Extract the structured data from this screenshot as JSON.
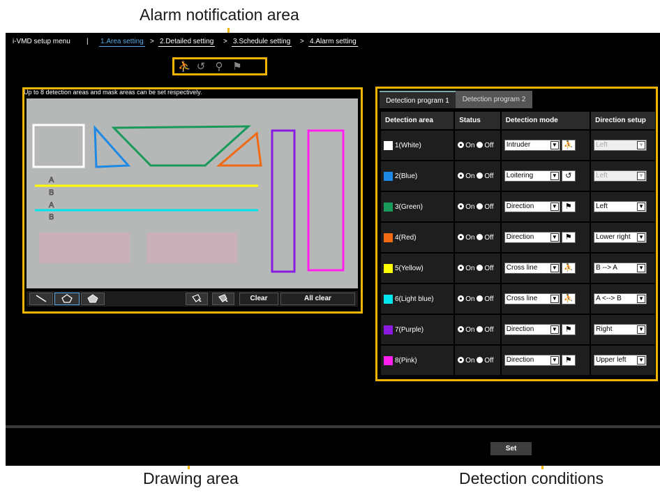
{
  "callouts": {
    "alarm": "Alarm notification area",
    "drawing": "Drawing area",
    "detection": "Detection conditions"
  },
  "nav": {
    "title": "i-VMD setup menu",
    "divider": "|",
    "steps": [
      "1.Area setting",
      "2.Detailed setting",
      "3.Schedule setting",
      "4.Alarm setting"
    ],
    "arrow": ">"
  },
  "alarm_icons": [
    "intruder-icon",
    "loitering-icon",
    "direction-icon",
    "cross-line-icon"
  ],
  "drawing": {
    "hint": "Up to 8 detection areas and mask areas can be set respectively.",
    "line_labels": [
      "A",
      "B",
      "A",
      "B"
    ],
    "toolbar": {
      "clear": "Clear",
      "all_clear": "All clear"
    }
  },
  "conditions": {
    "tabs": [
      "Detection program 1",
      "Detection program 2"
    ],
    "headers": [
      "Detection area",
      "Status",
      "Detection mode",
      "Direction setup"
    ],
    "status_on": "On",
    "status_off": "Off",
    "rows": [
      {
        "area": "1(White)",
        "color": "#ffffff",
        "mode": "Intruder",
        "direction": "Left",
        "dir_disabled": true
      },
      {
        "area": "2(Blue)",
        "color": "#1e88e5",
        "mode": "Loitering",
        "direction": "Left",
        "dir_disabled": true
      },
      {
        "area": "3(Green)",
        "color": "#1a9a5a",
        "mode": "Direction",
        "direction": "Left",
        "dir_disabled": false
      },
      {
        "area": "4(Red)",
        "color": "#f06a14",
        "mode": "Direction",
        "direction": "Lower right",
        "dir_disabled": false
      },
      {
        "area": "5(Yellow)",
        "color": "#ffff00",
        "mode": "Cross line",
        "direction": "B --> A",
        "dir_disabled": false
      },
      {
        "area": "6(Light blue)",
        "color": "#00e5ee",
        "mode": "Cross line",
        "direction": "A <--> B",
        "dir_disabled": false
      },
      {
        "area": "7(Purple)",
        "color": "#8a1ae0",
        "mode": "Direction",
        "direction": "Right",
        "dir_disabled": false
      },
      {
        "area": "8(Pink)",
        "color": "#ff20ee",
        "mode": "Direction",
        "direction": "Upper left",
        "dir_disabled": false
      }
    ]
  },
  "set_button": "Set",
  "colors": {
    "frame": "#f0b400",
    "accent": "#5aa9e6"
  }
}
